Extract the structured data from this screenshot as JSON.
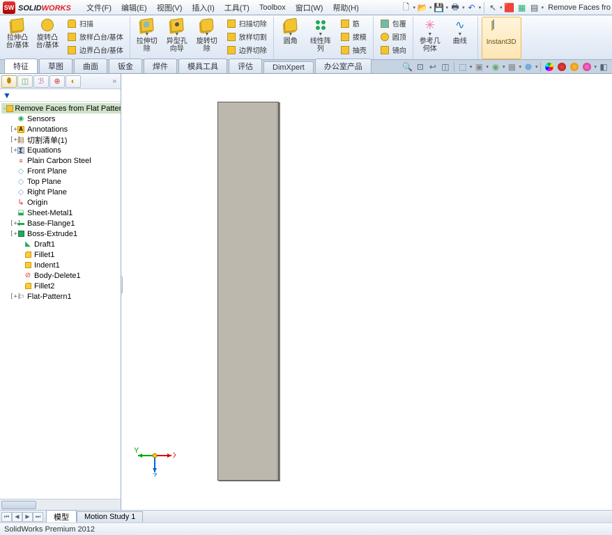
{
  "app": {
    "name_dark": "SOLID",
    "name_red": "WORKS",
    "doc_title": "Remove Faces fro"
  },
  "menu": [
    "文件(F)",
    "编辑(E)",
    "视图(V)",
    "插入(I)",
    "工具(T)",
    "Toolbox",
    "窗口(W)",
    "帮助(H)"
  ],
  "ribbon": {
    "big": {
      "extrude_boss": "拉伸凸\n台/基体",
      "revolve_boss": "旋转凸\n台/基体",
      "extrude_cut": "拉伸切\n除",
      "hole_wizard": "异型孔\n向导",
      "revolve_cut": "旋转切\n除",
      "fillet": "圆角",
      "linear_pattern": "线性阵\n列",
      "ref_geom": "参考几\n何体",
      "curves": "曲线",
      "instant3d": "Instant3D"
    },
    "small": {
      "sweep": "扫描",
      "loft_boss": "放样凸台/基体",
      "boundary_boss": "边界凸台/基体",
      "sweep_cut": "扫描切除",
      "loft_cut": "放样切割",
      "boundary_cut": "边界切除",
      "rib": "筋",
      "draft": "拔模",
      "shell": "抽壳",
      "wrap": "包覆",
      "dome": "圆顶",
      "mirror": "镜向"
    }
  },
  "tabs": [
    "特征",
    "草图",
    "曲面",
    "钣金",
    "焊件",
    "模具工具",
    "评估",
    "DimXpert",
    "办公室产品"
  ],
  "tabs_active": 0,
  "tree": {
    "root": "Remove Faces from Flat Patter",
    "items": [
      {
        "exp": "",
        "indent": 1,
        "icon": "sensor",
        "label": "Sensors"
      },
      {
        "exp": "+",
        "indent": 1,
        "icon": "annot",
        "label": "Annotations"
      },
      {
        "exp": "+",
        "indent": 1,
        "icon": "cutlist",
        "label": "切割清单(1)"
      },
      {
        "exp": "+",
        "indent": 1,
        "icon": "sigma",
        "label": "Equations"
      },
      {
        "exp": "",
        "indent": 1,
        "icon": "mat",
        "label": "Plain Carbon Steel"
      },
      {
        "exp": "",
        "indent": 1,
        "icon": "plane",
        "label": "Front Plane"
      },
      {
        "exp": "",
        "indent": 1,
        "icon": "plane",
        "label": "Top Plane"
      },
      {
        "exp": "",
        "indent": 1,
        "icon": "plane",
        "label": "Right Plane"
      },
      {
        "exp": "",
        "indent": 1,
        "icon": "origin",
        "label": "Origin"
      },
      {
        "exp": "",
        "indent": 1,
        "icon": "sheet",
        "label": "Sheet-Metal1"
      },
      {
        "exp": "+",
        "indent": 1,
        "icon": "flange",
        "label": "Base-Flange1"
      },
      {
        "exp": "+",
        "indent": 1,
        "icon": "boss",
        "label": "Boss-Extrude1"
      },
      {
        "exp": "",
        "indent": 2,
        "icon": "draft",
        "label": "Draft1"
      },
      {
        "exp": "",
        "indent": 2,
        "icon": "fillet",
        "label": "Fillet1"
      },
      {
        "exp": "",
        "indent": 2,
        "icon": "indent",
        "label": "Indent1"
      },
      {
        "exp": "",
        "indent": 2,
        "icon": "delete",
        "label": "Body-Delete1"
      },
      {
        "exp": "",
        "indent": 2,
        "icon": "fillet",
        "label": "Fillet2"
      },
      {
        "exp": "+",
        "indent": 1,
        "icon": "flat",
        "label": "Flat-Pattern1"
      }
    ]
  },
  "triad": {
    "x": "X",
    "y": "Y",
    "z": "Z"
  },
  "bottom_tabs": [
    "模型",
    "Motion Study 1"
  ],
  "status": "SolidWorks Premium 2012"
}
